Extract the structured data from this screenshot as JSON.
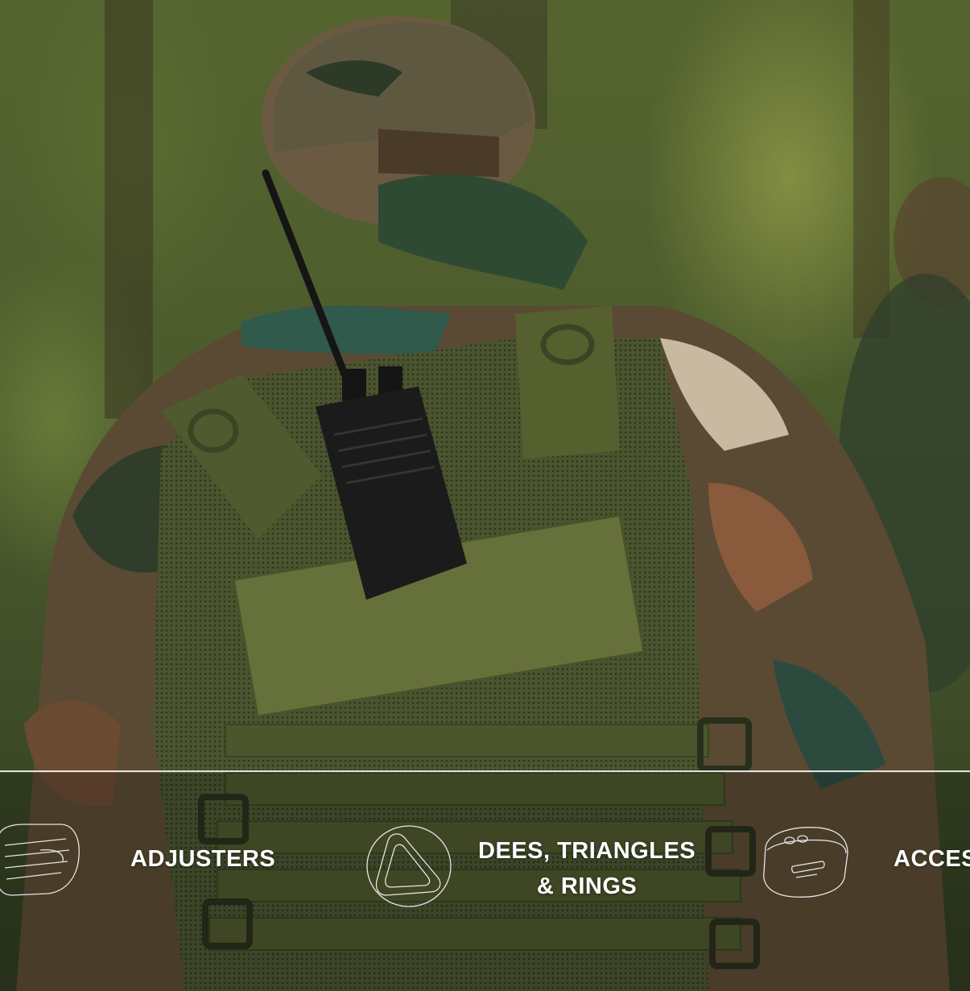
{
  "hero": {
    "image": "soldier-in-camouflage-with-tactical-vest-and-radio"
  },
  "categories": [
    {
      "label_line1": "ADJUSTERS",
      "label_line2": "",
      "icon": "adjuster-buckle-icon"
    },
    {
      "label_line1": "DEES, TRIANGLES",
      "label_line2": "& RINGS",
      "icon": "triangle-ring-icon"
    },
    {
      "label_line1": "ACCES",
      "label_line2": "",
      "icon": "accessory-buckle-icon"
    }
  ],
  "colors": {
    "text": "#ffffff",
    "divider": "#ffffff",
    "icon_stroke": "#e6e6e6"
  }
}
